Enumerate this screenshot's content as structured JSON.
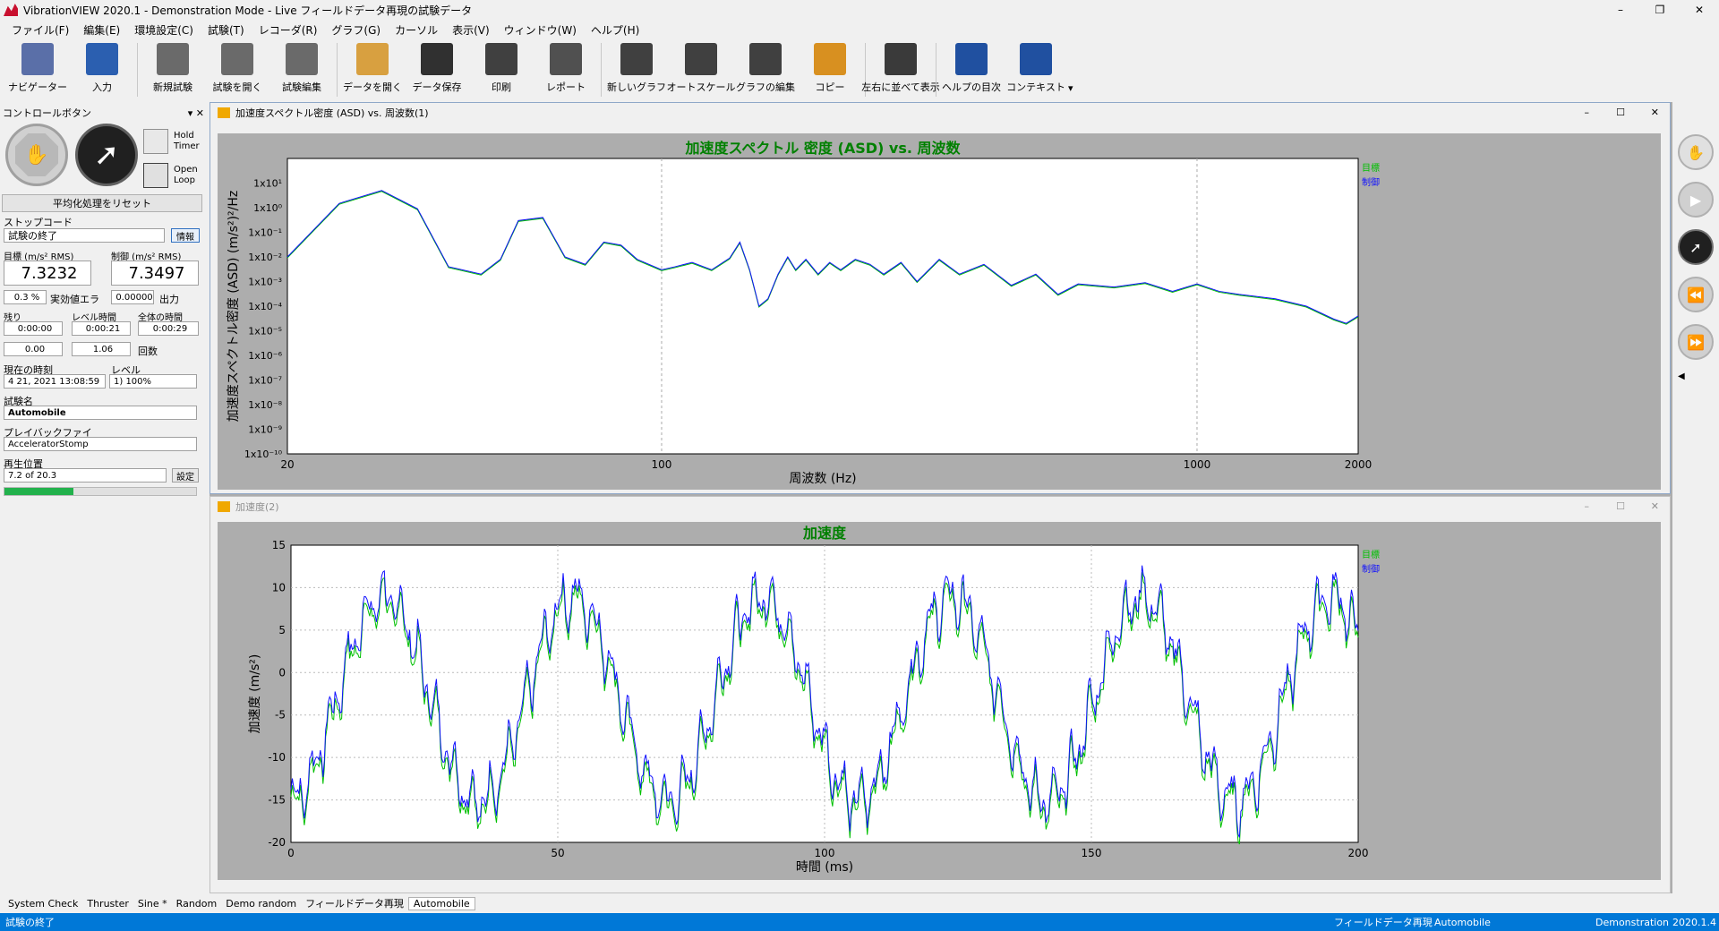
{
  "app": {
    "title": "VibrationVIEW 2020.1 - Demonstration Mode - Live  フィールドデータ再現の試験データ"
  },
  "menu": [
    "ファイル(F)",
    "編集(E)",
    "環境設定(C)",
    "試験(T)",
    "レコーダ(R)",
    "グラフ(G)",
    "カーソル",
    "表示(V)",
    "ウィンドウ(W)",
    "ヘルプ(H)"
  ],
  "toolbar": [
    {
      "label": "ナビゲーター",
      "icon": "navigator-icon",
      "color": "#5a6fa8"
    },
    {
      "label": "入力",
      "icon": "input-icon",
      "color": "#2b5fb0"
    },
    {
      "label": "新規試験",
      "icon": "new-test-gears-icon",
      "color": "#6a6a6a"
    },
    {
      "label": "試験を開く",
      "icon": "open-test-gears-icon",
      "color": "#6a6a6a"
    },
    {
      "label": "試験編集",
      "icon": "edit-test-gears-icon",
      "color": "#6a6a6a"
    },
    {
      "label": "データを開く",
      "icon": "open-data-icon",
      "color": "#d8a040"
    },
    {
      "label": "データ保存",
      "icon": "save-icon",
      "color": "#303030"
    },
    {
      "label": "印刷",
      "icon": "print-icon",
      "color": "#404040"
    },
    {
      "label": "レポート",
      "icon": "report-icon",
      "color": "#505050"
    },
    {
      "label": "新しいグラフ",
      "icon": "new-graph-icon",
      "color": "#404040"
    },
    {
      "label": "オートスケール",
      "icon": "autoscale-icon",
      "color": "#404040"
    },
    {
      "label": "グラフの編集",
      "icon": "edit-graph-icon",
      "color": "#404040"
    },
    {
      "label": "コピー",
      "icon": "copy-icon",
      "color": "#d89020"
    },
    {
      "label": "左右に並べて表示",
      "icon": "tile-vertical-icon",
      "color": "#3a3a3a"
    },
    {
      "label": "ヘルプの目次",
      "icon": "help-contents-icon",
      "color": "#2050a0"
    },
    {
      "label": "コンテキスト",
      "icon": "context-help-icon",
      "color": "#2050a0"
    }
  ],
  "control": {
    "header": "コントロールボタン",
    "hold_timer": "Hold Timer",
    "open_loop": "Open Loop",
    "reset_avg": "平均化処理をリセット",
    "stop_code_label": "ストップコード",
    "stop_code": "試験の終了",
    "info": "情報",
    "target_label": "目標 (m/s² RMS)",
    "control_label": "制御 (m/s² RMS)",
    "target_value": "7.3232",
    "control_value": "7.3497",
    "error_value": "0.3 %",
    "error_label": "実効値エラ",
    "output_value": "0.00000",
    "output_label": "出力",
    "remain_label": "残り",
    "level_time_label": "レベル時間",
    "total_time_label": "全体の時間",
    "remain": "0:00:00",
    "level_time": "0:00:21",
    "total_time": "0:00:29",
    "v1": "0.00",
    "v2": "1.06",
    "count_label": "回数",
    "now_label": "現在の時刻",
    "level_label": "レベル",
    "now": "4 21, 2021 13:08:59",
    "level": "1) 100%",
    "test_name_label": "試験名",
    "test_name": "Automobile",
    "playback_label": "プレイバックファイ",
    "playback": "AcceleratorStomp",
    "position_label": "再生位置",
    "position": "7.2 of 20.3",
    "set": "設定",
    "progress": 0.36
  },
  "window1": {
    "title": "加速度スペクトル密度 (ASD) vs. 周波数(1)"
  },
  "window2": {
    "title": "加速度(2)"
  },
  "chart_data": [
    {
      "type": "line",
      "title": "加速度スペクトル 密度 (ASD) vs. 周波数",
      "xlabel": "周波数 (Hz)",
      "ylabel": "加速度スペクトル密度 (ASD) (m/s²)²/Hz",
      "xscale": "log",
      "yscale": "log",
      "xlim": [
        20,
        2000
      ],
      "ylim": [
        1e-10,
        100
      ],
      "xticks": [
        "20",
        "100",
        "1000",
        "2000"
      ],
      "yticks": [
        "1x10¹",
        "1x10⁰",
        "1x10⁻¹",
        "1x10⁻²",
        "1x10⁻³",
        "1x10⁻⁴",
        "1x10⁻⁵",
        "1x10⁻⁶",
        "1x10⁻⁷",
        "1x10⁻⁸",
        "1x10⁻⁹",
        "1x10⁻¹⁰"
      ],
      "legend": [
        "目標",
        "制御"
      ],
      "legend_colors": [
        "#00c000",
        "#1010ff"
      ],
      "grid": true,
      "series": [
        {
          "name": "制御",
          "x": [
            20,
            25,
            30,
            35,
            40,
            46,
            50,
            54,
            60,
            66,
            72,
            78,
            84,
            90,
            100,
            106,
            114,
            124,
            134,
            140,
            146,
            152,
            158,
            165,
            172,
            178,
            186,
            196,
            206,
            216,
            230,
            245,
            260,
            280,
            300,
            330,
            360,
            400,
            450,
            500,
            550,
            600,
            700,
            800,
            900,
            1000,
            1100,
            1200,
            1400,
            1600,
            1800,
            1900,
            2000
          ],
          "y": [
            0.01,
            1.5,
            5,
            0.9,
            0.004,
            0.002,
            0.008,
            0.3,
            0.4,
            0.01,
            0.005,
            0.04,
            0.03,
            0.008,
            0.003,
            0.004,
            0.006,
            0.003,
            0.009,
            0.04,
            0.003,
            0.0001,
            0.0002,
            0.002,
            0.01,
            0.003,
            0.008,
            0.002,
            0.006,
            0.003,
            0.008,
            0.005,
            0.002,
            0.006,
            0.001,
            0.008,
            0.002,
            0.005,
            0.0007,
            0.002,
            0.0003,
            0.0008,
            0.0006,
            0.0009,
            0.0004,
            0.0008,
            0.0004,
            0.0003,
            0.0002,
            0.0001,
            3e-05,
            2e-05,
            4e-05
          ]
        }
      ]
    },
    {
      "type": "line",
      "title": "加速度",
      "xlabel": "時間 (ms)",
      "ylabel": "加速度 (m/s²)",
      "xlim": [
        0,
        200
      ],
      "ylim": [
        -20,
        15
      ],
      "xticks": [
        "0",
        "50",
        "100",
        "150",
        "200"
      ],
      "yticks": [
        "15",
        "10",
        "5",
        "0",
        "-5",
        "-10",
        "-15",
        "-20"
      ],
      "legend": [
        "目標",
        "制御"
      ],
      "legend_colors": [
        "#00c000",
        "#1010ff"
      ],
      "grid": true,
      "period_ms": 35.5,
      "amplitude": 12,
      "offset": -3
    }
  ],
  "tabs": [
    "System Check",
    "Thruster",
    "Sine *",
    "Random",
    "Demo random",
    "フィールドデータ再現",
    "Automobile"
  ],
  "status": {
    "left": "試験の終了",
    "mid1": "フィールドデータ再現",
    "mid2": "Automobile",
    "right1": "Demonstration",
    "right2": "2020.1.4"
  }
}
